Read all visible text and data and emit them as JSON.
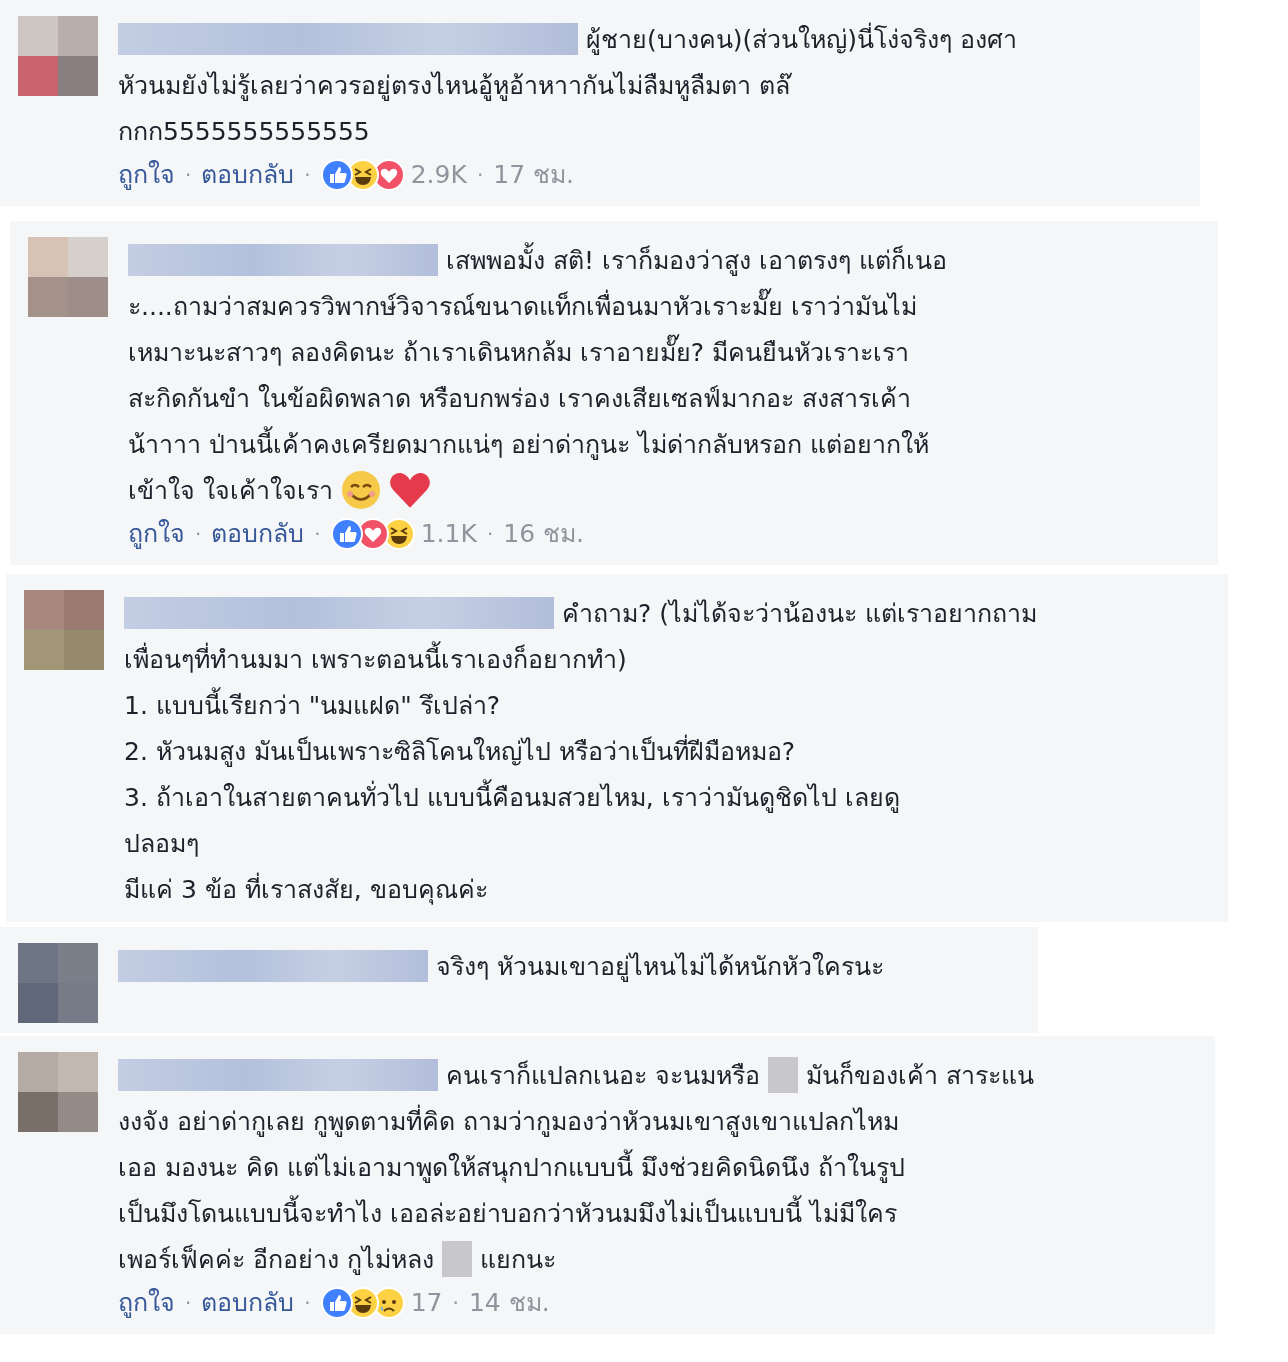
{
  "comments": [
    {
      "lines": [
        [
          {
            "kind": "text",
            "text": "ผู้ชาย(บางคน)(ส่วนใหญ่)นี่โง่จริงๆ องศา"
          }
        ],
        [
          {
            "kind": "text",
            "text": "หัวนมยังไม่รู้เลยว่าควรอยู่ตรงไหนอู้หูอ้าหาากันไม่ลืมหูลืมตา ตล๊"
          }
        ],
        [
          {
            "kind": "text",
            "text": "กกก5555555555555"
          }
        ]
      ],
      "actions": {
        "like": "ถูกใจ",
        "reply": "ตอบกลับ",
        "separator": "·",
        "reactions": [
          {
            "kind": "like"
          },
          {
            "kind": "haha"
          },
          {
            "kind": "love"
          }
        ],
        "count": "2.9K",
        "time": "17 ชม."
      }
    },
    {
      "lines": [
        [
          {
            "kind": "text",
            "text": "เสพพอมั้ง สติ! เราก็มองว่าสูง เอาตรงๆ แต่ก็เนอ"
          }
        ],
        [
          {
            "kind": "text",
            "text": "ะ....ถามว่าสมควรวิพากษ์วิจารณ์ขนาดแท็กเพื่อนมาหัวเราะมั๊ย เราว่ามันไม่"
          }
        ],
        [
          {
            "kind": "text",
            "text": "เหมาะนะสาวๆ ลองคิดนะ ถ้าเราเดินหกล้ม เราอายมั๊ย? มีคนยืนหัวเราะเรา"
          }
        ],
        [
          {
            "kind": "text",
            "text": "สะกิดกันขำ ในข้อผิดพลาด หรือบกพร่อง เราคงเสียเซลฟ์มากอะ สงสารเค้า"
          }
        ],
        [
          {
            "kind": "text",
            "text": "น้าาาา ป่านนี้เค้าคงเครียดมากแน่ๆ อย่าด่ากูนะ ไม่ด่ากลับหรอก แต่อยากให้"
          }
        ],
        [
          {
            "kind": "text",
            "text": "เข้าใจ ใจเค้าใจเรา"
          },
          {
            "kind": "smile"
          },
          {
            "kind": "heart"
          }
        ]
      ],
      "actions": {
        "like": "ถูกใจ",
        "reply": "ตอบกลับ",
        "separator": "·",
        "reactions": [
          {
            "kind": "like"
          },
          {
            "kind": "love"
          },
          {
            "kind": "haha"
          }
        ],
        "count": "1.1K",
        "time": "16 ชม."
      }
    },
    {
      "lines": [
        [
          {
            "kind": "text",
            "text": "คำถาม? (ไม่ได้จะว่าน้องนะ แต่เราอยากถาม"
          }
        ],
        [
          {
            "kind": "text",
            "text": "เพื่อนๆที่ทำนมมา เพราะตอนนี้เราเองก็อยากทำ)"
          }
        ],
        [
          {
            "kind": "text",
            "text": "1. แบบนี้เรียกว่า \"นมแฝด\" รึเปล่า?"
          }
        ],
        [
          {
            "kind": "text",
            "text": "2. หัวนมสูง มันเป็นเพราะซิลิโคนใหญ่ไป หรือว่าเป็นที่ฝีมือหมอ?"
          }
        ],
        [
          {
            "kind": "text",
            "text": "3. ถ้าเอาในสายตาคนทั่วไป แบบนี้คือนมสวยไหม, เราว่ามันดูชิดไป เลยดู"
          }
        ],
        [
          {
            "kind": "text",
            "text": "ปลอมๆ"
          }
        ],
        [
          {
            "kind": "text",
            "text": "มีแค่ 3 ข้อ ที่เราสงสัย, ขอบคุณค่ะ"
          }
        ]
      ]
    },
    {
      "lines": [
        [
          {
            "kind": "text",
            "text": "จริงๆ หัวนมเขาอยู่ไหนไม่ได้หนักหัวใครนะ"
          }
        ]
      ]
    },
    {
      "lines": [
        [
          {
            "kind": "text",
            "text": "คนเราก็แปลกเนอะ จะนมหรือ"
          },
          {
            "kind": "censor"
          },
          {
            "kind": "text",
            "text": "มันก็ของเค้า สาระแน"
          }
        ],
        [
          {
            "kind": "text",
            "text": "งงจัง อย่าด่ากูเลย กูพูดตามที่คิด ถามว่ากูมองว่าหัวนมเขาสูงเขาแปลกไหม"
          }
        ],
        [
          {
            "kind": "text",
            "text": "เออ มองนะ คิด แต่ไม่เอามาพูดให้สนุกปากแบบนี้ มึงช่วยคิดนิดนึง ถ้าในรูป"
          }
        ],
        [
          {
            "kind": "text",
            "text": "เป็นมึงโดนแบบนี้จะทำไง เออล่ะอย่าบอกว่าหัวนมมึงไม่เป็นแบบนี้ ไม่มีใคร"
          }
        ],
        [
          {
            "kind": "text",
            "text": "เพอร์เฟ็คค่ะ อีกอย่าง กูไม่หลง"
          },
          {
            "kind": "censor"
          },
          {
            "kind": "text",
            "text": "แยกนะ"
          }
        ]
      ],
      "actions": {
        "like": "ถูกใจ",
        "reply": "ตอบกลับ",
        "separator": "·",
        "reactions": [
          {
            "kind": "like"
          },
          {
            "kind": "haha"
          },
          {
            "kind": "sad"
          }
        ],
        "count": "17",
        "time": "14 ชม."
      }
    }
  ]
}
